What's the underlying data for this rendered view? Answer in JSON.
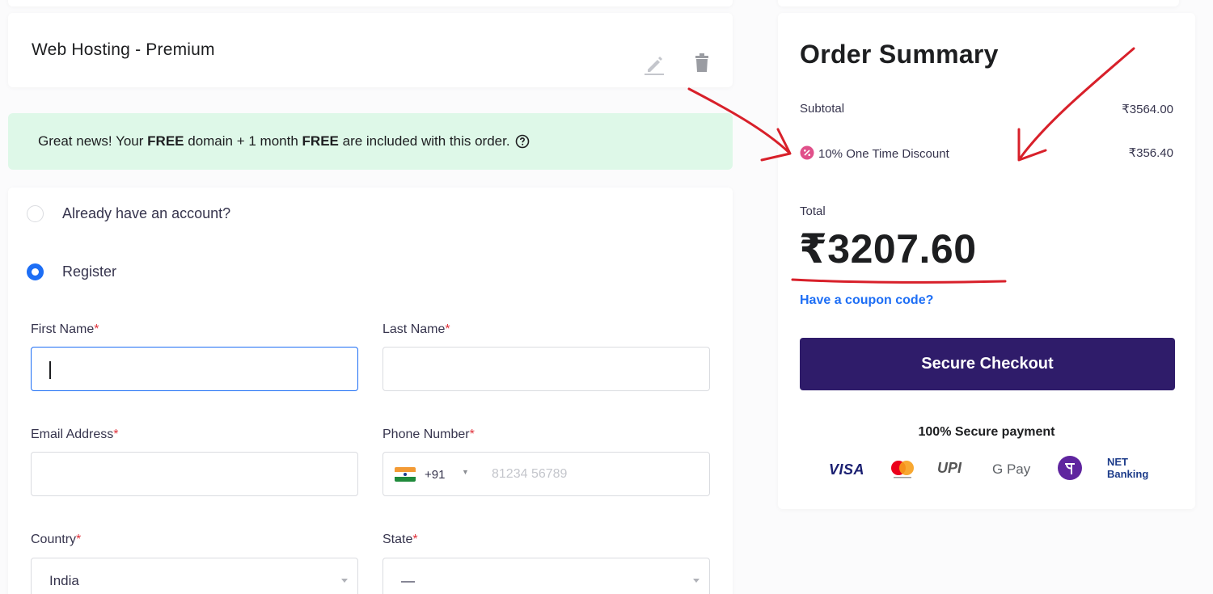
{
  "product": {
    "title": "Web Hosting - Premium",
    "edit_icon": "pencil-icon",
    "delete_icon": "trash-icon"
  },
  "banner": {
    "text_part1": "Great news! Your ",
    "bold1": "FREE",
    "text_part2": " domain + 1 month ",
    "bold2": "FREE",
    "text_part3": " are included with this order.",
    "icon": "question-circle-icon",
    "bg_color": "#def8e8"
  },
  "account": {
    "options": [
      {
        "label": "Already have an account?",
        "selected": false
      },
      {
        "label": "Register",
        "selected": true
      }
    ]
  },
  "form": {
    "required_mark": "*",
    "first_name": {
      "label": "First Name",
      "value": ""
    },
    "last_name": {
      "label": "Last Name",
      "value": ""
    },
    "email": {
      "label": "Email Address",
      "value": ""
    },
    "phone": {
      "label": "Phone Number",
      "country_code": "+91",
      "placeholder": "81234 56789",
      "flag": "india-flag-icon"
    },
    "country": {
      "label": "Country",
      "value": "India"
    },
    "state": {
      "label": "State",
      "value": "—"
    }
  },
  "summary": {
    "title": "Order Summary",
    "subtotal_label": "Subtotal",
    "subtotal_value": "₹3564.00",
    "discount_label": "10% One Time Discount",
    "discount_value": "₹356.40",
    "discount_icon": "discount-badge-icon",
    "total_label": "Total",
    "total_value": "₹3207.60",
    "coupon_link": "Have a coupon code?",
    "checkout_button": "Secure Checkout",
    "secure_text": "100% Secure payment",
    "payment_methods": {
      "visa": "VISA",
      "mastercard": "mastercard-icon",
      "upi": "UPI",
      "gpay": "G Pay",
      "phonepe": "phonepe-icon",
      "net_line1": "NET",
      "net_line2": "Banking"
    },
    "accent_color": "#2f1c6a",
    "link_color": "#1d6ef5"
  }
}
